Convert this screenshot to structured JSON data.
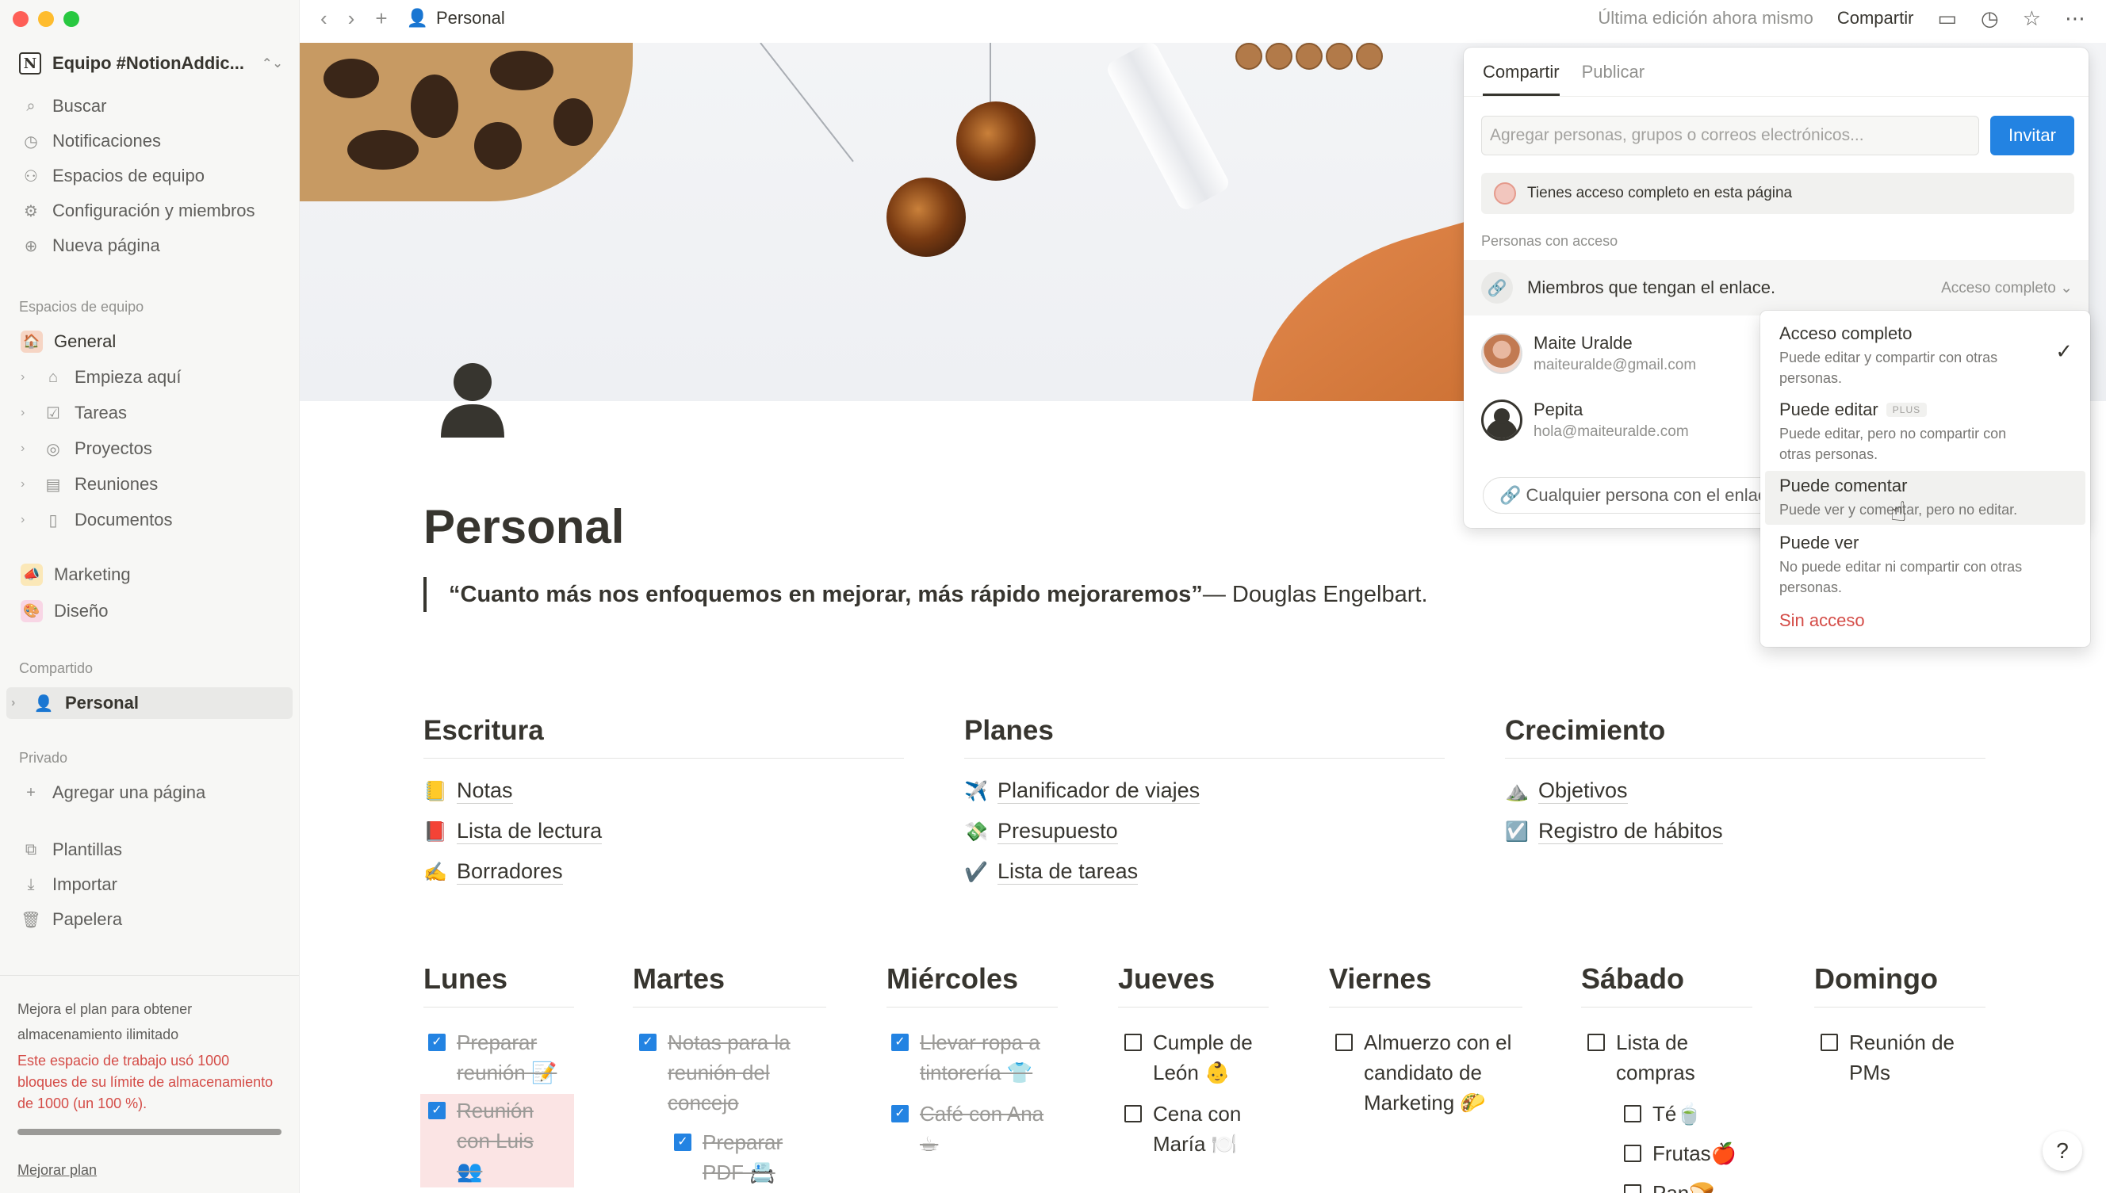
{
  "workspace": {
    "name": "Equipo #NotionAddic..."
  },
  "sidebar": {
    "top_items": [
      {
        "label": "Buscar",
        "icon": "search-icon"
      },
      {
        "label": "Notificaciones",
        "icon": "clock-icon"
      },
      {
        "label": "Espacios de equipo",
        "icon": "teamspace-icon"
      },
      {
        "label": "Configuración y miembros",
        "icon": "gear-icon"
      },
      {
        "label": "Nueva página",
        "icon": "plus-circle-icon"
      }
    ],
    "team_section": "Espacios de equipo",
    "team_items": [
      {
        "label": "General"
      },
      {
        "label": "Empieza aquí"
      },
      {
        "label": "Tareas"
      },
      {
        "label": "Proyectos"
      },
      {
        "label": "Reuniones"
      },
      {
        "label": "Documentos"
      },
      {
        "label": "Marketing"
      },
      {
        "label": "Diseño"
      }
    ],
    "shared_section": "Compartido",
    "shared_items": [
      {
        "label": "Personal"
      }
    ],
    "private_section": "Privado",
    "add_page": "Agregar una página",
    "bottom_items": [
      {
        "label": "Plantillas"
      },
      {
        "label": "Importar"
      },
      {
        "label": "Papelera"
      }
    ],
    "upgrade_line1": "Mejora el plan para obtener",
    "upgrade_line2": "almacenamiento ilimitado",
    "warning": "Este espacio de trabajo usó 1000 bloques de su límite de almacenamiento de 1000 (un 100 %).",
    "storage_used_fraction": 1.0,
    "upgrade_link": "Mejorar plan"
  },
  "topbar": {
    "breadcrumb": "Personal",
    "last_edit": "Última edición ahora mismo",
    "share_label": "Compartir"
  },
  "page": {
    "title": "Personal",
    "quote_bold": "“Cuanto más nos enfoquemos en mejorar, más rápido mejoraremos”",
    "quote_author": "— Douglas Engelbart.",
    "columns": [
      {
        "heading": "Escritura",
        "items": [
          {
            "emoji": "📒",
            "label": "Notas"
          },
          {
            "emoji": "📕",
            "label": "Lista de lectura"
          },
          {
            "emoji": "✍️",
            "label": "Borradores"
          }
        ]
      },
      {
        "heading": "Planes",
        "items": [
          {
            "emoji": "✈️",
            "label": "Planificador de viajes"
          },
          {
            "emoji": "💸",
            "label": "Presupuesto"
          },
          {
            "emoji": "✔️",
            "label": "Lista de tareas"
          }
        ]
      },
      {
        "heading": "Crecimiento",
        "items": [
          {
            "emoji": "⛰️",
            "label": "Objetivos"
          },
          {
            "emoji": "☑️",
            "label": "Registro de hábitos"
          }
        ]
      }
    ],
    "days": [
      {
        "name": "Lunes",
        "todos": [
          {
            "text": "Preparar reunión 📝",
            "done": true
          },
          {
            "text": "Reunión con Luis 👥",
            "done": true
          }
        ]
      },
      {
        "name": "Martes",
        "todos": [
          {
            "text": "Notas para la reunión del concejo",
            "done": true
          },
          {
            "text": "Preparar PDF 📇",
            "done": true
          }
        ]
      },
      {
        "name": "Miércoles",
        "todos": [
          {
            "text": "Llevar ropa a tintorería 👕",
            "done": true
          },
          {
            "text": "Café con Ana ☕",
            "done": true
          }
        ]
      },
      {
        "name": "Jueves",
        "todos": [
          {
            "text": "Cumple de León 👶",
            "done": false
          },
          {
            "text": "Cena con María 🍽️",
            "done": false
          }
        ]
      },
      {
        "name": "Viernes",
        "todos": [
          {
            "text": "Almuerzo con el candidato de Marketing 🌮",
            "done": false
          }
        ]
      },
      {
        "name": "Sábado",
        "todos": [
          {
            "text": "Lista de compras",
            "done": false
          },
          {
            "text": "Té🍵",
            "done": false
          },
          {
            "text": "Frutas🍎",
            "done": false
          },
          {
            "text": "Pan🍞",
            "done": false
          }
        ]
      },
      {
        "name": "Domingo",
        "todos": [
          {
            "text": "Reunión de PMs",
            "done": false
          }
        ]
      }
    ]
  },
  "share_panel": {
    "tabs": [
      "Compartir",
      "Publicar"
    ],
    "input_placeholder": "Agregar personas, grupos o correos electrónicos...",
    "invite_label": "Invitar",
    "access_notice": "Tienes acceso completo en esta página",
    "people_section": "Personas con acceso",
    "link_members": "Miembros que tengan el enlace.",
    "link_access": "Acceso completo ⌄",
    "people": [
      {
        "name": "Maite Uralde",
        "email": "maiteuralde@gmail.com"
      },
      {
        "name": "Pepita",
        "email": "hola@maiteuralde.com"
      }
    ],
    "anyone_link": "Cualquier persona con el enlace"
  },
  "access_dropdown": {
    "options": [
      {
        "title": "Acceso completo",
        "desc": "Puede editar y compartir con otras personas.",
        "selected": true
      },
      {
        "title": "Puede editar",
        "badge": "PLUS",
        "desc": "Puede editar, pero no compartir con otras personas."
      },
      {
        "title": "Puede comentar",
        "desc": "Puede ver y comentar, pero no editar."
      },
      {
        "title": "Puede ver",
        "desc": "No puede editar ni compartir con otras personas."
      }
    ],
    "no_access": "Sin acceso"
  },
  "help_label": "?"
}
